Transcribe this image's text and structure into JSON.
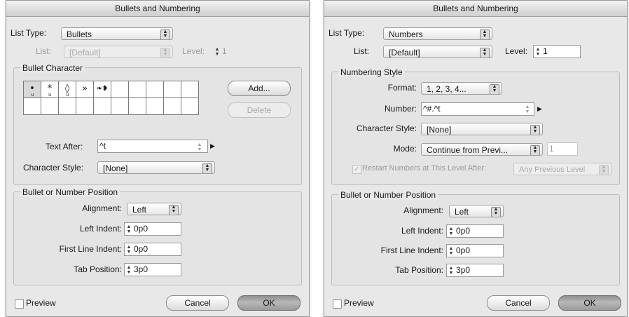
{
  "dialogs": [
    {
      "title": "Bullets and Numbering",
      "list_type_label": "List Type:",
      "list_type_value": "Bullets",
      "list_label": "List:",
      "list_value": "[Default]",
      "level_label": "Level:",
      "level_value": "1",
      "bullet_character": {
        "legend": "Bullet Character",
        "glyphs": [
          "•",
          "*",
          "◊",
          "»",
          "❧❥"
        ],
        "add_button": "Add...",
        "delete_button": "Delete",
        "text_after_label": "Text After:",
        "text_after_value": "^t",
        "char_style_label": "Character Style:",
        "char_style_value": "[None]"
      },
      "position": {
        "legend": "Bullet or Number Position",
        "alignment_label": "Alignment:",
        "alignment_value": "Left",
        "left_indent_label": "Left Indent:",
        "left_indent_value": "0p0",
        "first_line_label": "First Line Indent:",
        "first_line_value": "0p0",
        "tab_position_label": "Tab Position:",
        "tab_position_value": "3p0"
      },
      "preview_label": "Preview",
      "cancel_label": "Cancel",
      "ok_label": "OK"
    },
    {
      "title": "Bullets and Numbering",
      "list_type_label": "List Type:",
      "list_type_value": "Numbers",
      "list_label": "List:",
      "list_value": "[Default]",
      "level_label": "Level:",
      "level_value": "1",
      "numbering_style": {
        "legend": "Numbering Style",
        "format_label": "Format:",
        "format_value": "1, 2, 3, 4...",
        "number_label": "Number:",
        "number_value": "^#.^t",
        "char_style_label": "Character Style:",
        "char_style_value": "[None]",
        "mode_label": "Mode:",
        "mode_value": "Continue from Previ...",
        "mode_number": "1",
        "restart_label": "Restart Numbers at This Level After:",
        "restart_value": "Any Previous Level"
      },
      "position": {
        "legend": "Bullet or Number Position",
        "alignment_label": "Alignment:",
        "alignment_value": "Left",
        "left_indent_label": "Left Indent:",
        "left_indent_value": "0p0",
        "first_line_label": "First Line Indent:",
        "first_line_value": "0p0",
        "tab_position_label": "Tab Position:",
        "tab_position_value": "3p0"
      },
      "preview_label": "Preview",
      "cancel_label": "Cancel",
      "ok_label": "OK"
    }
  ]
}
